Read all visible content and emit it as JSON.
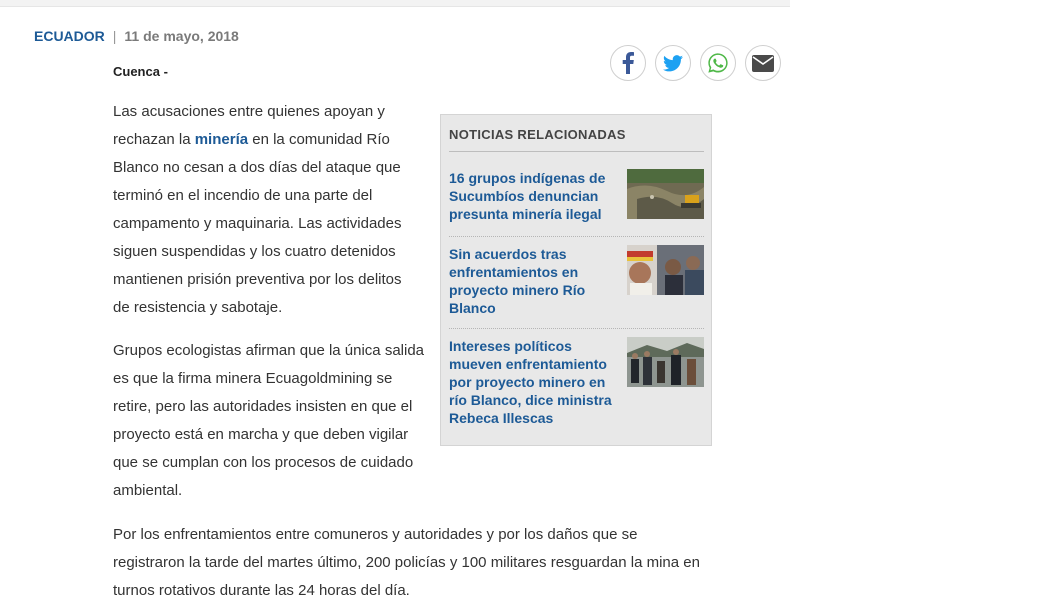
{
  "meta": {
    "section": "ECUADOR",
    "separator": "|",
    "date": "11 de mayo, 2018"
  },
  "share": {
    "icons": [
      "facebook-icon",
      "twitter-icon",
      "whatsapp-icon",
      "email-icon"
    ],
    "colors": {
      "facebook": "#3b5998",
      "twitter": "#1da1f2",
      "whatsapp": "#4fb848",
      "email": "#4a4a4a"
    }
  },
  "article": {
    "dateline": "Cuenca -",
    "p1": {
      "before": "Las acusaciones entre quienes apoyan y rechazan la ",
      "keyword": "minería",
      "after": " en la comunidad Río Blanco no cesan a dos días del ataque que terminó en el incendio de una parte del campamento y maquinaria. Las actividades siguen suspendidas y los cuatro detenidos mantienen prisión preventiva por los delitos de resistencia y sabotaje."
    },
    "p2": "Grupos ecologistas afirman que la única salida es que la firma minera Ecuagoldmining se retire, pero las autoridades insisten en que el proyecto está en marcha y que deben vigilar que se cumplan con los procesos de cuidado ambiental.",
    "p3": "Por los enfrentamientos entre comuneros y autoridades y por los daños que se registraron la tarde del martes último, 200 policías y 100 militares resguardan la mina en turnos rotativos durante las 24 horas del día."
  },
  "related": {
    "title": "NOTICIAS RELACIONADAS",
    "items": [
      {
        "title": "16 grupos indígenas de Sucumbíos denuncian presunta minería ilegal"
      },
      {
        "title": "Sin acuerdos tras enfrentamientos en proyecto minero Río Blanco"
      },
      {
        "title": "Intereses políticos mueven enfrentamiento por proyecto minero en río Blanco, dice ministra Rebeca Illescas"
      }
    ]
  },
  "colors": {
    "link": "#1d5a96",
    "box_bg": "#e8e8e8"
  }
}
